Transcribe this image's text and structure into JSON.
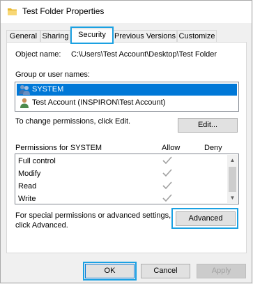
{
  "window": {
    "title": "Test Folder Properties"
  },
  "tabs": [
    {
      "label": "General"
    },
    {
      "label": "Sharing"
    },
    {
      "label": "Security"
    },
    {
      "label": "Previous Versions"
    },
    {
      "label": "Customize"
    }
  ],
  "security": {
    "object_name_label": "Object name:",
    "object_name_value": "C:\\Users\\Test Account\\Desktop\\Test Folder",
    "group_label": "Group or user names:",
    "users": [
      {
        "name": "SYSTEM",
        "icon": "user-group-icon",
        "selected": true
      },
      {
        "name": "Test Account (INSPIRON\\Test Account)",
        "icon": "user-icon",
        "selected": false
      }
    ],
    "change_hint": "To change permissions, click Edit.",
    "edit_label": "Edit...",
    "permissions_header": "Permissions for SYSTEM",
    "allow_header": "Allow",
    "deny_header": "Deny",
    "permissions": [
      {
        "name": "Full control",
        "allow": true,
        "deny": false
      },
      {
        "name": "Modify",
        "allow": true,
        "deny": false
      },
      {
        "name": "Read",
        "allow": true,
        "deny": false
      },
      {
        "name": "Write",
        "allow": true,
        "deny": false
      }
    ],
    "special_hint_line1": "For special permissions or advanced settings,",
    "special_hint_line2": "click Advanced.",
    "advanced_label": "Advanced"
  },
  "footer": {
    "ok_label": "OK",
    "cancel_label": "Cancel",
    "apply_label": "Apply"
  },
  "colors": {
    "highlight": "#1ba1e2",
    "selection": "#0078d7",
    "check": "#a0a0a0"
  }
}
